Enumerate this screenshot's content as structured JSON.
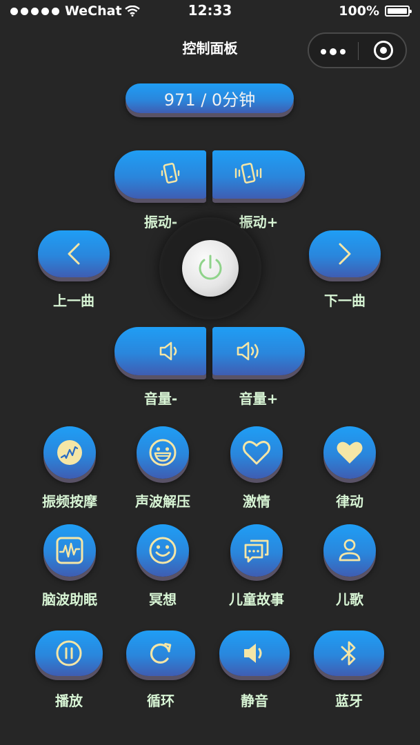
{
  "status_bar": {
    "carrier": "WeChat",
    "time": "12:33",
    "battery": "100%"
  },
  "nav": {
    "title": "控制面板"
  },
  "timer": {
    "text": "971 / 0分钟"
  },
  "vibration": {
    "minus_label": "振动-",
    "plus_label": "振动+"
  },
  "track": {
    "prev_label": "上一曲",
    "next_label": "下一曲"
  },
  "volume": {
    "minus_label": "音量-",
    "plus_label": "音量+"
  },
  "modes": [
    {
      "label": "振频按摩",
      "icon": "massage-wave-icon"
    },
    {
      "label": "声波解压",
      "icon": "laugh-face-icon"
    },
    {
      "label": "激情",
      "icon": "heart-outline-icon"
    },
    {
      "label": "律动",
      "icon": "heart-filled-icon"
    },
    {
      "label": "脑波助眠",
      "icon": "brainwave-icon"
    },
    {
      "label": "冥想",
      "icon": "smile-face-icon"
    },
    {
      "label": "儿童故事",
      "icon": "chat-bubble-icon"
    },
    {
      "label": "儿歌",
      "icon": "user-icon"
    }
  ],
  "controls": [
    {
      "label": "播放",
      "icon": "pause-icon"
    },
    {
      "label": "循环",
      "icon": "loop-icon"
    },
    {
      "label": "静音",
      "icon": "speaker-icon"
    },
    {
      "label": "蓝牙",
      "icon": "bluetooth-icon"
    }
  ],
  "colors": {
    "background": "#262626",
    "button_top": "#1f9ef5",
    "button_bottom": "#3f5db2",
    "icon": "#f5e6a6",
    "label": "#d8f5d5",
    "power_ring": "#8fd38a"
  }
}
